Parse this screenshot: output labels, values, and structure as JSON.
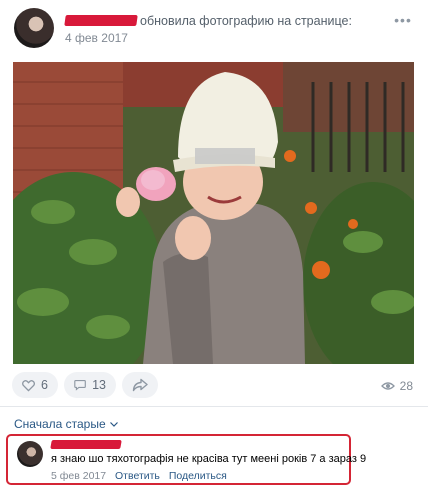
{
  "post": {
    "action_text": "обновила фотографию на странице:",
    "date": "4 фев 2017",
    "more_icon": "more-dots-icon"
  },
  "actions": {
    "likes": "6",
    "comments": "13",
    "views": "28",
    "like_icon": "heart-icon",
    "comment_icon": "comment-icon",
    "share_icon": "share-icon",
    "views_icon": "eye-icon"
  },
  "comments_section": {
    "sort_label": "Сначала старые",
    "comments": [
      {
        "text": "я знаю шо тяхотографія не красіва тут меені років 7 а зараз 9",
        "date": "5 фев 2017",
        "reply_label": "Ответить",
        "share_label": "Поделиться"
      }
    ]
  },
  "colors": {
    "link": "#2a5885",
    "redaction": "#d8193a",
    "highlight_border": "#d42535"
  }
}
